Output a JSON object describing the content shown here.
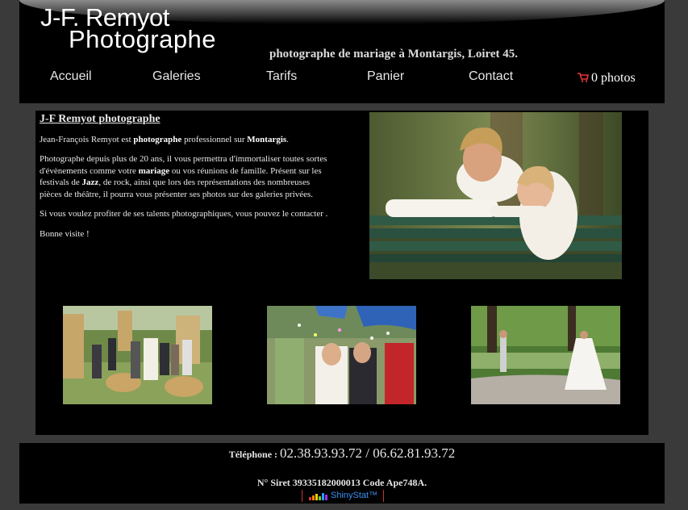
{
  "header": {
    "logo_line1": "J-F. Remyot",
    "logo_line2": "Photographe",
    "tagline": "photographe de mariage à Montargis, Loiret 45."
  },
  "nav": {
    "items": [
      {
        "label": "Accueil"
      },
      {
        "label": "Galeries"
      },
      {
        "label": "Tarifs"
      },
      {
        "label": "Panier"
      },
      {
        "label": "Contact"
      }
    ]
  },
  "cart": {
    "label": "0 photos",
    "icon": "cart-icon"
  },
  "intro": {
    "title": "J-F Remyot photographe",
    "p1_pre": "Jean-François Remyot est ",
    "p1_b1": "photographe",
    "p1_mid": " professionnel sur ",
    "p1_b2": "Montargis",
    "p1_end": ".",
    "p2_a": "Photographe depuis plus de 20 ans, il vous permettra d'immortaliser toutes sortes d'évènements comme votre ",
    "p2_b1": "mariage",
    "p2_b": " ou vos réunions de famille. Présent sur les festivals de ",
    "p2_b2": "Jazz",
    "p2_c": ", de rock, ainsi que lors des représentations des nombreuses pièces de théâtre, il pourra vous présenter ses photos sur des galeries privées.",
    "p3": "Si vous voulez profiter de ses talents photographiques, vous pouvez le contacter .",
    "p4": "Bonne visite !"
  },
  "footer": {
    "phone_label": "Téléphone : ",
    "phone_numbers": "02.38.93.93.72 / 06.62.81.93.72",
    "siret": "N° Siret 39335182000013 Code Ape748A.",
    "badge": "ShinyStat™"
  },
  "colors": {
    "background": "#3a3a3a",
    "panel": "#000000",
    "text": "#e6e6e6",
    "badge_text": "#3c8ff0"
  }
}
